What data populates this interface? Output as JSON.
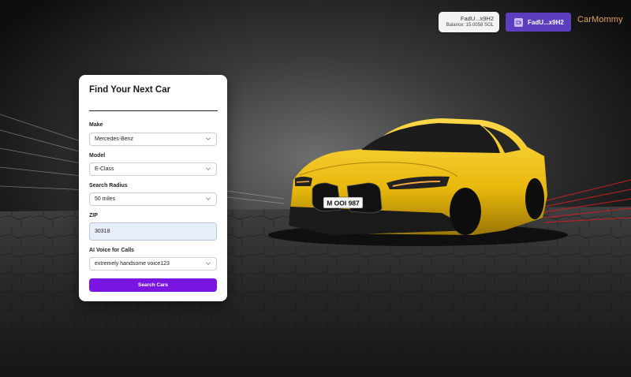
{
  "header": {
    "wallet_address": "FadU...x9H2",
    "wallet_balance": "Balance: 15.0058 SOL",
    "wallet_button_label": "FadU...x9H2",
    "brand_name": "CarMommy"
  },
  "car_plate": "M OOI 987",
  "form": {
    "title": "Find Your Next Car",
    "make": {
      "label": "Make",
      "value": "Mercedes-Benz"
    },
    "model": {
      "label": "Model",
      "value": "E-Class"
    },
    "radius": {
      "label": "Search Radius",
      "value": "50 miles"
    },
    "zip": {
      "label": "ZIP",
      "value": "30318"
    },
    "voice": {
      "label": "AI Voice for Calls",
      "value": "extremely handsome voice123"
    },
    "submit_label": "Search Cars"
  },
  "colors": {
    "accent": "#7a14e0",
    "wallet_button": "#5b3fbf",
    "brand": "#e3a45a",
    "car": "#f2c40f"
  }
}
